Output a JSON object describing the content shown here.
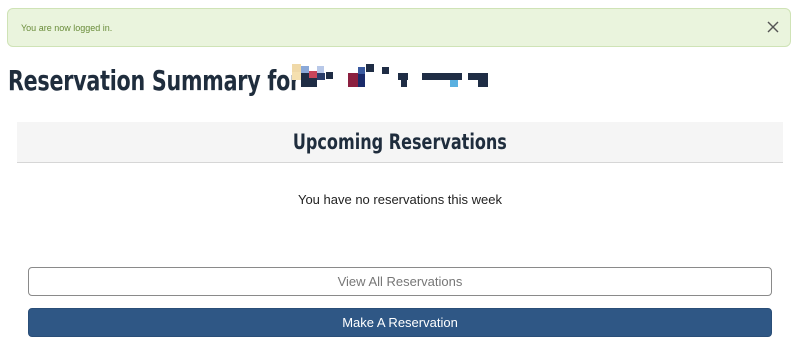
{
  "alert": {
    "message": "You are now logged in.",
    "close_icon": "close-icon",
    "colors": {
      "background": "#eaf4dd",
      "border": "#cfe3b6",
      "text": "#6a8c3a"
    }
  },
  "header": {
    "title": "Reservation Summary for"
  },
  "upcoming": {
    "heading": "Upcoming Reservations",
    "empty_message": "You have no reservations this week"
  },
  "actions": {
    "view_all_label": "View All Reservations",
    "make_reservation_label": "Make A Reservation",
    "primary_color": "#2f5785"
  }
}
